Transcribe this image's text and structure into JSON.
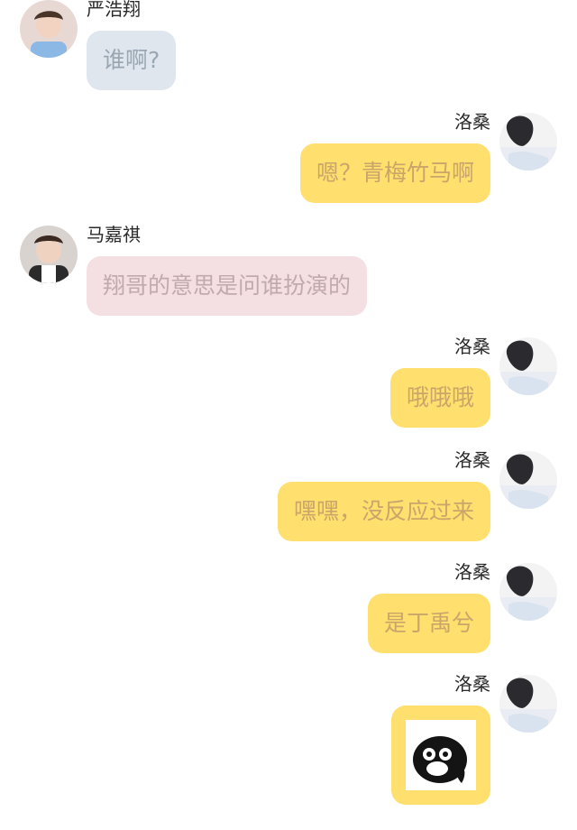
{
  "messages": [
    {
      "id": "m1",
      "side": "left",
      "sender": "严浩翔",
      "text": "谁啊?",
      "bubble_color": "blue"
    },
    {
      "id": "m2",
      "side": "right",
      "sender": "洛桑",
      "text": "嗯？青梅竹马啊",
      "bubble_color": "yellow"
    },
    {
      "id": "m3",
      "side": "left",
      "sender": "马嘉祺",
      "text": "翔哥的意思是问谁扮演的",
      "bubble_color": "pink"
    },
    {
      "id": "m4",
      "side": "right",
      "sender": "洛桑",
      "text": "哦哦哦",
      "bubble_color": "yellow"
    },
    {
      "id": "m5",
      "side": "right",
      "sender": "洛桑",
      "text": "嘿嘿，没反应过来",
      "bubble_color": "yellow"
    },
    {
      "id": "m6",
      "side": "right",
      "sender": "洛桑",
      "text": "是丁禹兮",
      "bubble_color": "yellow"
    },
    {
      "id": "m7",
      "side": "right",
      "sender": "洛桑",
      "sticker": "penguin-sticker",
      "bubble_color": "yellow"
    }
  ],
  "colors": {
    "yellow_bubble": "#ffe06e",
    "blue_bubble": "#dfe6ee",
    "pink_bubble": "#f4dfe2"
  }
}
